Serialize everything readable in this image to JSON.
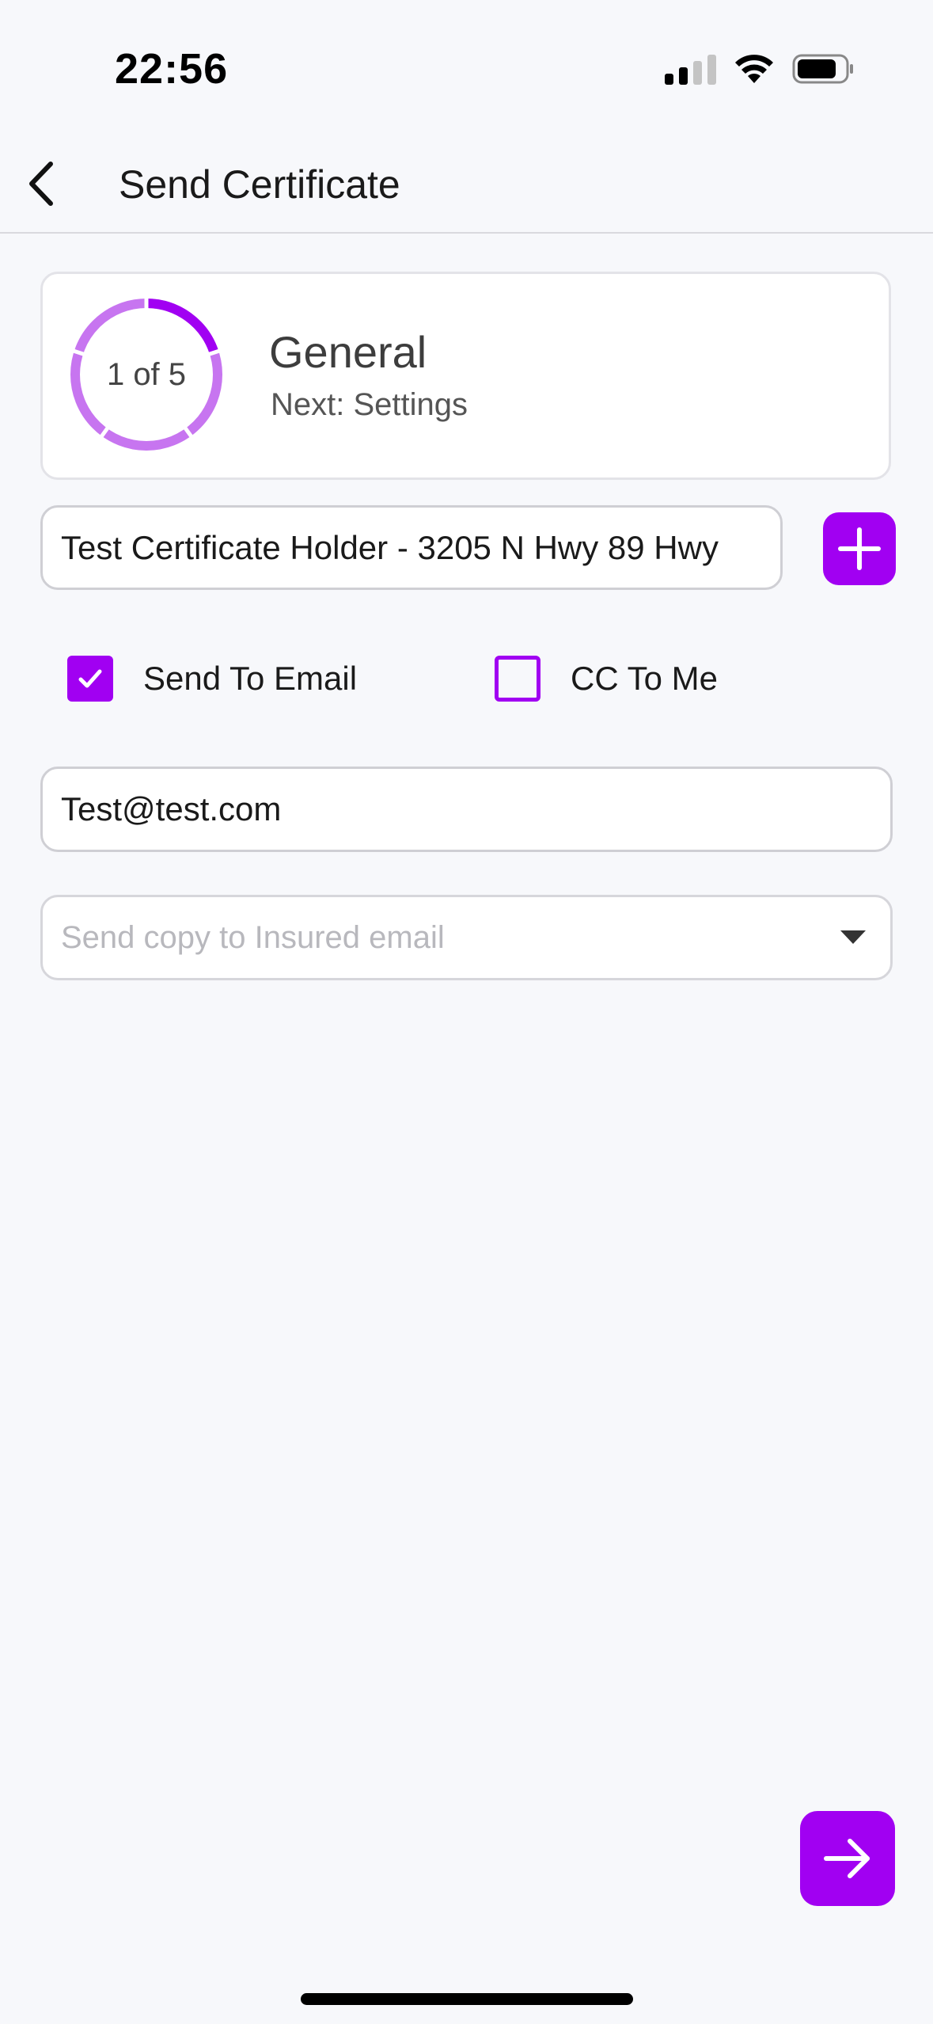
{
  "status_bar": {
    "time": "22:56",
    "icons": [
      "cellular-signal-icon",
      "wifi-icon",
      "battery-icon"
    ]
  },
  "header": {
    "back_icon": "chevron-left-icon",
    "title": "Send Certificate"
  },
  "step_card": {
    "progress_label": "1 of 5",
    "current_step": 1,
    "total_steps": 5,
    "title": "General",
    "next_label": "Next: Settings"
  },
  "certificate_holder": {
    "value": "Test Certificate Holder - 3205 N Hwy 89 Hwy",
    "add_icon": "plus-icon"
  },
  "options": {
    "send_to_email": {
      "label": "Send To Email",
      "checked": true
    },
    "cc_to_me": {
      "label": "CC To Me",
      "checked": false
    }
  },
  "email": {
    "value": "Test@test.com"
  },
  "copy_select": {
    "placeholder": "Send copy to Insured email",
    "icon": "dropdown-triangle-icon"
  },
  "footer": {
    "next_icon": "arrow-right-icon"
  },
  "colors": {
    "accent": "#a100f2",
    "progress_light": "#c775f0",
    "background": "#f7f8fb"
  }
}
